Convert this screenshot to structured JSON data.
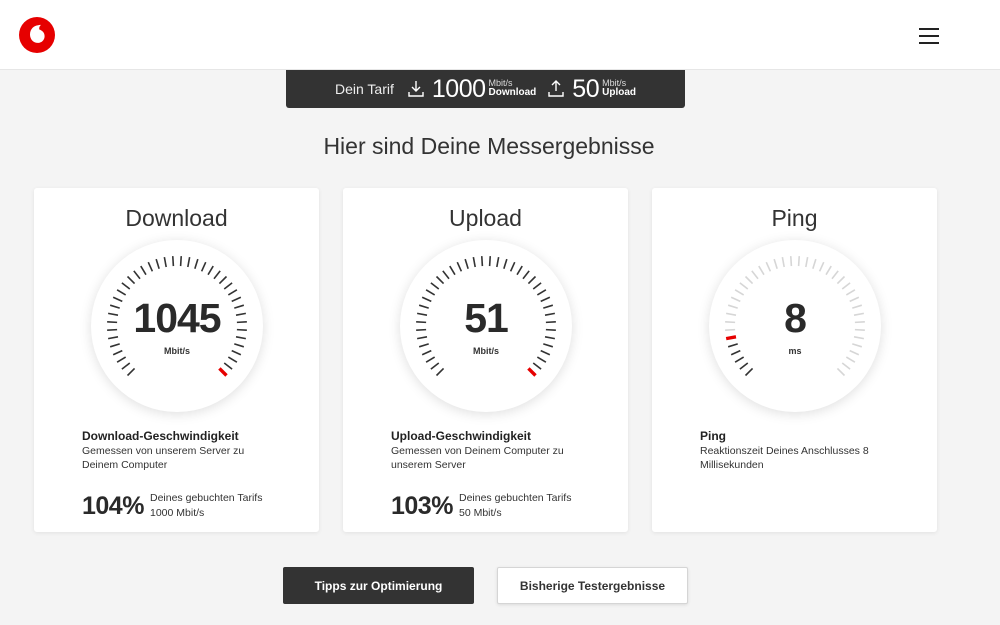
{
  "header": {
    "logo_icon": "vodafone-logo-icon",
    "menu_icon": "hamburger-menu-icon",
    "brand_color": "#e60000"
  },
  "tariff": {
    "label": "Dein Tarif",
    "download": {
      "value": "1000",
      "unit": "Mbit/s",
      "direction": "Download",
      "icon": "download-icon"
    },
    "upload": {
      "value": "50",
      "unit": "Mbit/s",
      "direction": "Upload",
      "icon": "upload-icon"
    }
  },
  "heading": "Hier sind Deine Messergebnisse",
  "cards": {
    "download": {
      "title": "Download",
      "value": "1045",
      "unit": "Mbit/s",
      "gauge_fraction": 1.0,
      "subtitle": "Download-Geschwindigkeit",
      "description": "Gemessen von unserem Server zu Deinem Computer",
      "percent": "104%",
      "percent_label": "Deines gebuchten Tarifs",
      "tariff_value": "1000 Mbit/s"
    },
    "upload": {
      "title": "Upload",
      "value": "51",
      "unit": "Mbit/s",
      "gauge_fraction": 1.0,
      "subtitle": "Upload-Geschwindigkeit",
      "description": "Gemessen von Deinem Computer zu unserem Server",
      "percent": "103%",
      "percent_label": "Deines gebuchten Tarifs",
      "tariff_value": "50 Mbit/s"
    },
    "ping": {
      "title": "Ping",
      "value": "8",
      "unit": "ms",
      "gauge_fraction": 0.12,
      "subtitle": "Ping",
      "description": "Reaktionszeit Deines Anschlusses 8 Millisekunden"
    }
  },
  "buttons": {
    "tips": "Tipps zur Optimierung",
    "history": "Bisherige Testergebnisse"
  }
}
